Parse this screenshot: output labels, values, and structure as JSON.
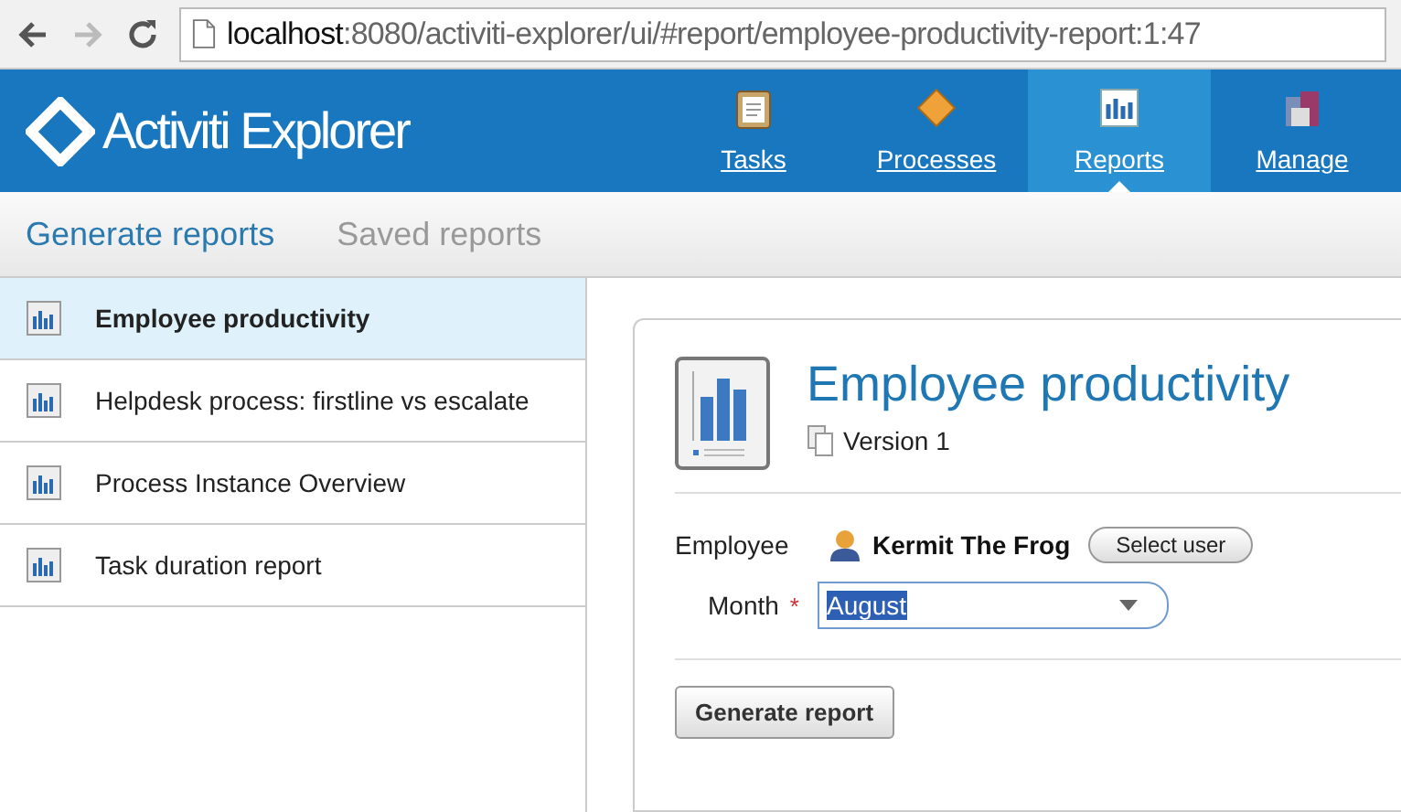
{
  "browser": {
    "url_host": "localhost",
    "url_path": ":8080/activiti-explorer/ui/#report/employee-productivity-report:1:47"
  },
  "header": {
    "logo": "Activiti Explorer",
    "nav": [
      {
        "label": "Tasks",
        "selected": false
      },
      {
        "label": "Processes",
        "selected": false
      },
      {
        "label": "Reports",
        "selected": true
      },
      {
        "label": "Manage",
        "selected": false
      }
    ]
  },
  "subtabs": [
    {
      "label": "Generate reports",
      "selected": true
    },
    {
      "label": "Saved reports",
      "selected": false
    }
  ],
  "reports": [
    {
      "label": "Employee productivity",
      "selected": true
    },
    {
      "label": "Helpdesk process: firstline vs escalate",
      "selected": false
    },
    {
      "label": "Process Instance Overview",
      "selected": false
    },
    {
      "label": "Task duration report",
      "selected": false
    }
  ],
  "detail": {
    "title": "Employee productivity",
    "version": "Version 1",
    "employee": {
      "label": "Employee",
      "user": "Kermit The Frog",
      "button": "Select user"
    },
    "month": {
      "label": "Month",
      "required_mark": "*",
      "value": "August",
      "value_highlighted": true
    },
    "submit": "Generate report"
  }
}
